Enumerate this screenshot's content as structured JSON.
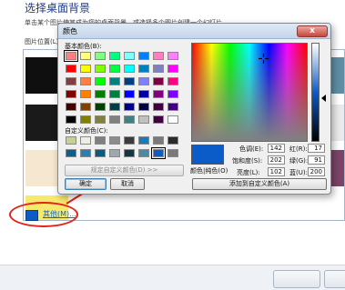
{
  "page": {
    "title": "选择桌面背景",
    "description": "单击某个图片使其成为您的桌面背景，或选择多个图片创建一个幻灯片。",
    "picture_position_label": "图片位置(L):",
    "other_link": "其他(M)...",
    "palette_colors": [
      "#0f0f0f",
      "#bf2c2c",
      "#05628e",
      "#1c84b4",
      "#222222",
      "#0f4764",
      "#5d8ea4",
      "#1a1a1a",
      "#d2d8a8",
      "#c8c06e",
      "#f0b400",
      "#7a6a3e",
      "#e9e4c9",
      "#eaeaea",
      "#f6e7d0",
      "#e0cc84",
      "#c8a878",
      "#be1d2e",
      "#d9507e",
      "#aa2f58",
      "#7a4468",
      "#f7e86e"
    ]
  },
  "dialog": {
    "title": "颜色",
    "close_label": "x",
    "basic_colors_label": "基本颜色(B):",
    "basic_colors": [
      "#ff8080",
      "#ffff80",
      "#80ff80",
      "#00ff80",
      "#80ffff",
      "#0080ff",
      "#ff80c0",
      "#ff80ff",
      "#ff0000",
      "#ffff00",
      "#80ff00",
      "#00ff40",
      "#00ffff",
      "#0080c0",
      "#8080c0",
      "#ff00ff",
      "#804040",
      "#ff8040",
      "#00ff00",
      "#008080",
      "#004080",
      "#8080ff",
      "#800040",
      "#ff0080",
      "#800000",
      "#ff8000",
      "#008000",
      "#008040",
      "#0000ff",
      "#0000a0",
      "#800080",
      "#8000ff",
      "#400000",
      "#804000",
      "#004000",
      "#004040",
      "#000080",
      "#000040",
      "#400040",
      "#400080",
      "#000000",
      "#808000",
      "#808040",
      "#808080",
      "#408080",
      "#c0c0c0",
      "#400040",
      "#ffffff"
    ],
    "custom_colors_label": "自定义颜色(C):",
    "custom_colors": [
      "#c5d28c",
      "#eeeee2",
      "#808080",
      "#8c8c8c",
      "#3c3c3c",
      "#1b7bb8",
      "#7a7a7a",
      "#2a2a2a",
      "#0a5f8c",
      "#2b7fb0",
      "#0a5b82",
      "#9ca8b0",
      "#163545",
      "#4a8aa5",
      "#0b5bc9",
      "#7a7a7a"
    ],
    "define_custom_label": "规定自定义颜色(D) >>",
    "ok_label": "确定",
    "cancel_label": "取消",
    "color_solid_label": "颜色|纯色(O)",
    "hue_label": "色调(E):",
    "hue_value": "142",
    "sat_label": "饱和度(S):",
    "sat_value": "202",
    "lum_label": "亮度(L):",
    "lum_value": "102",
    "red_label": "红(R):",
    "red_value": "17",
    "green_label": "绿(G):",
    "green_value": "91",
    "blue_label": "蓝(U):",
    "blue_value": "200",
    "add_custom_label": "添加到自定义颜色(A)",
    "current_color": "#0b5bc9"
  }
}
